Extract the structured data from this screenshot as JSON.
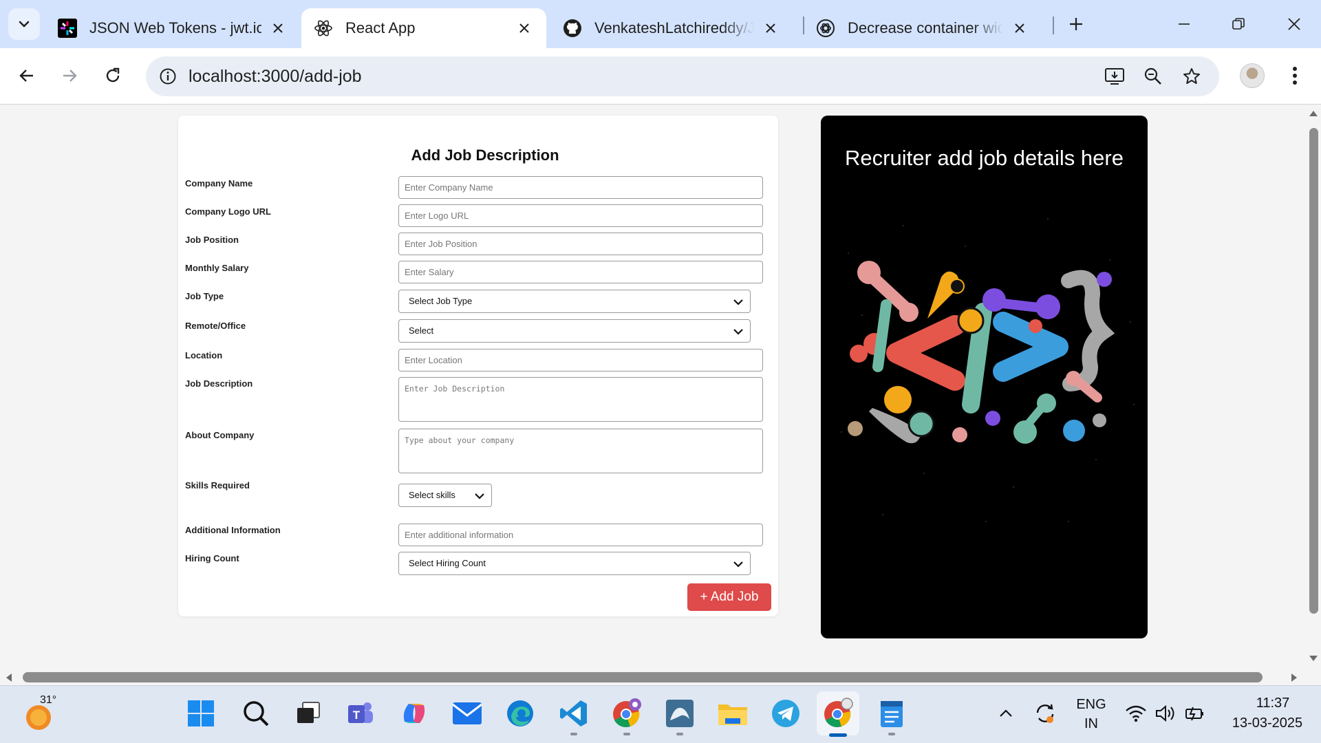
{
  "browser": {
    "tabs": [
      {
        "title": "JSON Web Tokens - jwt.io",
        "icon": "jwt-icon",
        "active": false
      },
      {
        "title": "React App",
        "icon": "react-icon",
        "active": true
      },
      {
        "title": "VenkateshLatchireddy/Job",
        "icon": "github-icon",
        "active": false
      },
      {
        "title": "Decrease container widths",
        "icon": "chatgpt-icon",
        "active": false
      }
    ],
    "url": "localhost:3000/add-job"
  },
  "form": {
    "title": "Add Job Description",
    "fields": {
      "company_name": {
        "label": "Company Name",
        "placeholder": "Enter Company Name"
      },
      "logo_url": {
        "label": "Company Logo URL",
        "placeholder": "Enter Logo URL"
      },
      "job_position": {
        "label": "Job Position",
        "placeholder": "Enter Job Position"
      },
      "salary": {
        "label": "Monthly Salary",
        "placeholder": "Enter Salary"
      },
      "job_type": {
        "label": "Job Type",
        "selected": "Select Job Type"
      },
      "remote_office": {
        "label": "Remote/Office",
        "selected": "Select"
      },
      "location": {
        "label": "Location",
        "placeholder": "Enter Location"
      },
      "job_description": {
        "label": "Job Description",
        "placeholder": "Enter Job Description"
      },
      "about_company": {
        "label": "About Company",
        "placeholder": "Type about your company"
      },
      "skills": {
        "label": "Skills Required",
        "selected": "Select skills"
      },
      "additional_info": {
        "label": "Additional Information",
        "placeholder": "Enter additional information"
      },
      "hiring_count": {
        "label": "Hiring Count",
        "selected": "Select Hiring Count"
      }
    },
    "submit_label": "+ Add Job"
  },
  "side_panel": {
    "title": "Recruiter add job details here"
  },
  "taskbar": {
    "weather_temp": "31°",
    "language_top": "ENG",
    "language_bottom": "IN",
    "time": "11:37",
    "date": "13-03-2025",
    "apps": [
      "start",
      "search",
      "task-view",
      "teams",
      "copilot",
      "mail",
      "edge",
      "vscode",
      "chrome-incognito",
      "mysql-workbench",
      "file-explorer",
      "telegram",
      "chrome",
      "notepad"
    ]
  },
  "colors": {
    "tabstrip": "#d3e3fd",
    "accent_button": "#df4a4a",
    "side_panel_bg": "#000000",
    "taskbar_active": "#005fb8"
  }
}
